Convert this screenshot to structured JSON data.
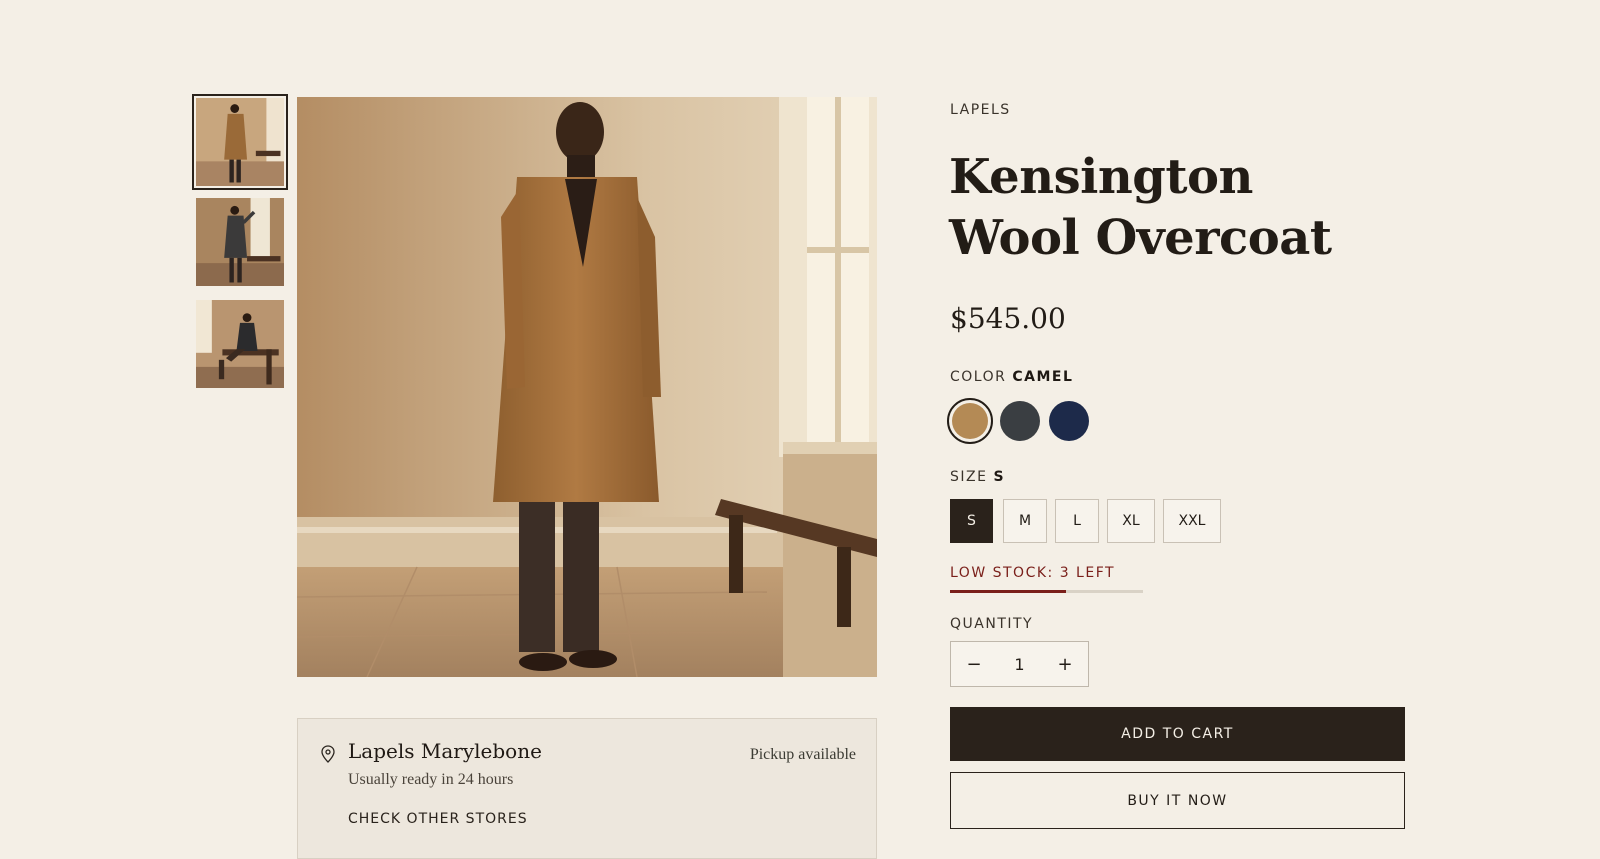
{
  "product": {
    "brand": "LAPELS",
    "title_line1": "Kensington",
    "title_line2": "Wool Overcoat",
    "price": "$545.00"
  },
  "gallery": {
    "thumbnails": [
      {
        "icon": "photo-standing-front"
      },
      {
        "icon": "photo-by-window"
      },
      {
        "icon": "photo-seated-bench"
      }
    ],
    "active_index": 0
  },
  "color": {
    "label": "COLOR",
    "selected": "CAMEL",
    "swatches": [
      {
        "hex": "#b48a55",
        "active": true
      },
      {
        "hex": "#3a3e42",
        "active": false
      },
      {
        "hex": "#1d2a4a",
        "active": false
      }
    ]
  },
  "size": {
    "label": "SIZE",
    "selected": "S",
    "options": [
      "S",
      "M",
      "L",
      "XL",
      "XXL"
    ]
  },
  "stock": {
    "label": "LOW STOCK: 3 LEFT",
    "level_fraction": 0.6
  },
  "quantity": {
    "label": "QUANTITY",
    "minus": "−",
    "value": "1",
    "plus": "+"
  },
  "actions": {
    "add_to_cart": "ADD TO CART",
    "buy_now": "BUY IT NOW"
  },
  "pickup": {
    "store_name": "Lapels Marylebone",
    "status": "Pickup available",
    "ready_text": "Usually ready in 24 hours",
    "check_link": "CHECK OTHER STORES"
  },
  "colors": {
    "background": "#f4efe6",
    "dark": "#2a221b",
    "stock_red": "#7a1f1a",
    "pickup_bg": "#ede7dd"
  }
}
